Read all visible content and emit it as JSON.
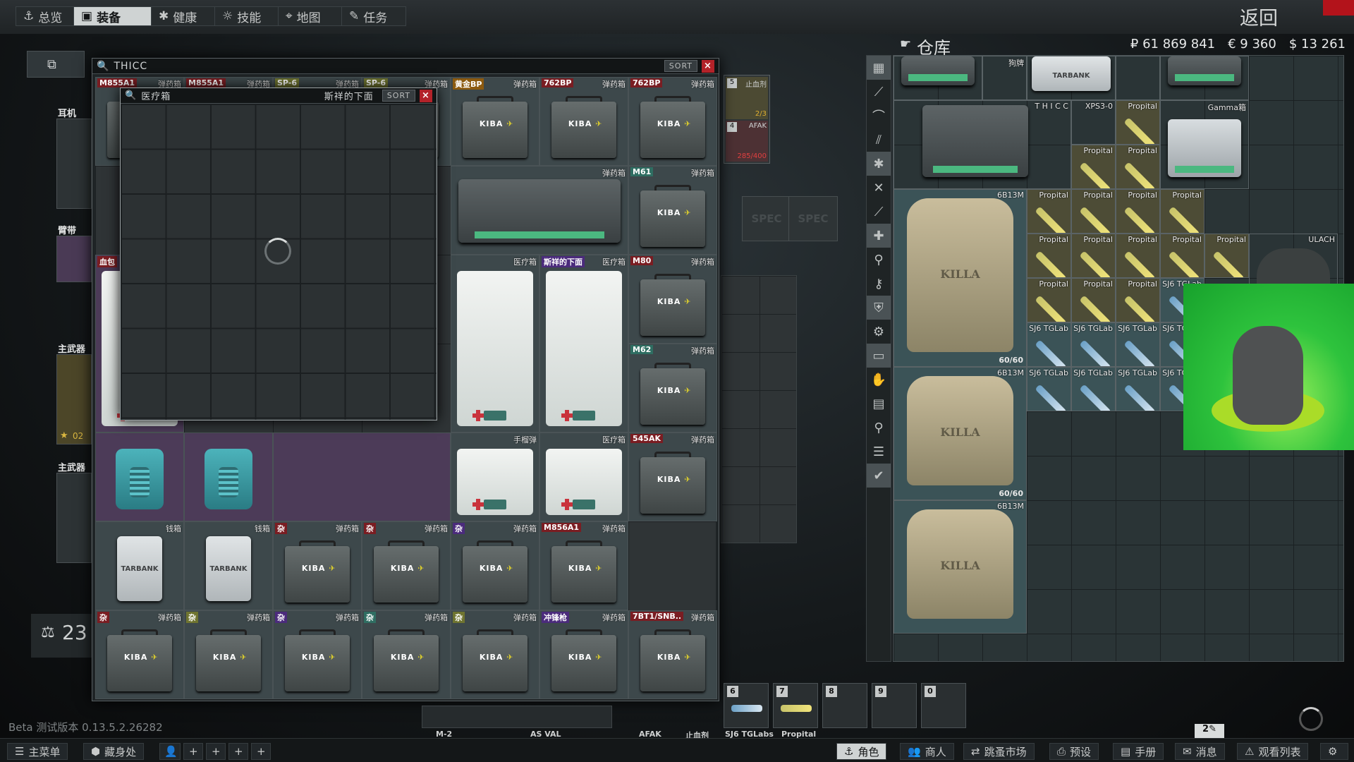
{
  "topnav": {
    "items": [
      {
        "label": "总览",
        "icon": "anchor-icon"
      },
      {
        "label": "装备",
        "icon": "backpack-icon"
      },
      {
        "label": "健康",
        "icon": "health-icon"
      },
      {
        "label": "技能",
        "icon": "skills-icon"
      },
      {
        "label": "地图",
        "icon": "map-pin-icon"
      },
      {
        "label": "任务",
        "icon": "tasks-icon"
      }
    ],
    "active": "装备",
    "back": "返回"
  },
  "container_window": {
    "title": "THICC",
    "sort": "SORT",
    "close": "×"
  },
  "container_items": [
    {
      "tag": "M855A1",
      "name": "弹药箱"
    },
    {
      "tag": "M855A1",
      "name": "弹药箱"
    },
    {
      "tag": "SP-6",
      "name": "弹药箱"
    },
    {
      "tag": "SP-6",
      "name": "弹药箱"
    },
    {
      "tag": "黄金BP",
      "name": "弹药箱"
    },
    {
      "tag": "762BP",
      "name": "弹药箱"
    },
    {
      "tag": "762BP",
      "name": "弹药箱"
    },
    {
      "tag": "",
      "name": "弹药箱"
    },
    {
      "tag": "M61",
      "name": "弹药箱"
    },
    {
      "tag": "血包",
      "name": ""
    },
    {
      "tag": "",
      "name": "医疗箱"
    },
    {
      "tag": "斯祥的下面",
      "name": "医疗箱"
    },
    {
      "tag": "M80",
      "name": "弹药箱"
    },
    {
      "tag": "M62",
      "name": "弹药箱"
    },
    {
      "tag": "",
      "name": "手榴弹"
    },
    {
      "tag": "",
      "name": "医疗箱"
    },
    {
      "tag": "545AK",
      "name": "弹药箱"
    },
    {
      "tag": "",
      "name": "钱箱"
    },
    {
      "tag": "",
      "name": "钱箱"
    },
    {
      "tag": "杂",
      "name": "弹药箱"
    },
    {
      "tag": "杂",
      "name": "弹药箱"
    },
    {
      "tag": "杂",
      "name": "弹药箱"
    },
    {
      "tag": "M856A1",
      "name": "弹药箱"
    },
    {
      "tag": "杂",
      "name": "弹药箱"
    },
    {
      "tag": "杂",
      "name": "弹药箱"
    },
    {
      "tag": "杂",
      "name": "弹药箱"
    },
    {
      "tag": "杂",
      "name": "弹药箱"
    },
    {
      "tag": "杂",
      "name": "弹药箱"
    },
    {
      "tag": "冲锋枪",
      "name": "弹药箱"
    },
    {
      "tag": "7BT1/SNB..",
      "name": "弹药箱"
    }
  ],
  "ammo_logo": {
    "brand": "KIBA",
    "mark": "✈"
  },
  "medcase_window": {
    "title": "医疗箱",
    "tag": "斯祥的下面",
    "sort": "SORT",
    "close": "×"
  },
  "pouch": {
    "slot_a": "5",
    "name_a": "止血剂",
    "count_a": "2/3",
    "slot_b": "4",
    "name_b": "AFAK",
    "count_b": "285/400"
  },
  "spec_slots": [
    "SPEC",
    "SPEC"
  ],
  "equipment": {
    "labels": [
      "耳机",
      "臂带",
      "主武器",
      "主武器"
    ],
    "level": "02",
    "weight": "23"
  },
  "stash": {
    "title": "仓库",
    "currency": [
      "₽ 61 869 841",
      "€ 9 360",
      "$ 13 261"
    ],
    "items": [
      {
        "name": "狗牌"
      },
      {
        "name": "TARBANK"
      },
      {
        "name": "T H I C C"
      },
      {
        "name": "XPS3-0"
      },
      {
        "name": "Gamma箱"
      },
      {
        "name": "6B13M",
        "durability": "60/60"
      },
      {
        "name": "6B13M",
        "durability": "60/60"
      },
      {
        "name": "6B13M"
      },
      {
        "name": "Propital"
      },
      {
        "name": "SJ6 TGLab"
      },
      {
        "name": "ULACH"
      }
    ],
    "vest_text": "KILLA"
  },
  "quick_slots": [
    {
      "n": "6",
      "label": "SJ6 TGLabs"
    },
    {
      "n": "7",
      "label": "Propital"
    },
    {
      "n": "8",
      "label": ""
    },
    {
      "n": "9",
      "label": ""
    },
    {
      "n": "0",
      "label": ""
    }
  ],
  "weapon_slots": [
    "M-2",
    "AS VAL",
    "AFAK",
    "止血剂"
  ],
  "version": "Beta 测试版本 0.13.5.2.26282",
  "bottom": {
    "items": [
      {
        "label": "主菜单",
        "icon": "menu-icon"
      },
      {
        "label": "藏身处",
        "icon": "hideout-icon"
      },
      {
        "label": "角色",
        "icon": "character-icon"
      },
      {
        "label": "商人",
        "icon": "traders-icon"
      },
      {
        "label": "跳蚤市场",
        "icon": "flea-icon"
      },
      {
        "label": "预设",
        "icon": "presets-icon"
      },
      {
        "label": "手册",
        "icon": "handbook-icon"
      },
      {
        "label": "消息",
        "icon": "messages-icon"
      },
      {
        "label": "观看列表",
        "icon": "watchlist-icon"
      }
    ],
    "active": "角色",
    "counter": "2"
  }
}
